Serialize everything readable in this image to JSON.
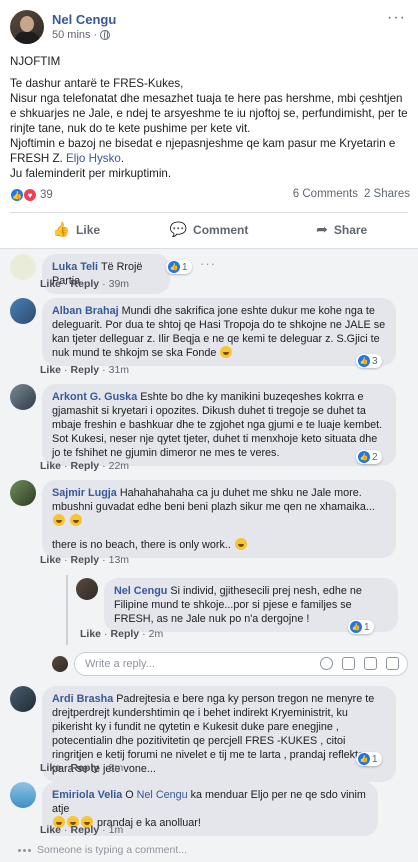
{
  "post": {
    "author": "Nel Cengu",
    "time": "50 mins",
    "meta_sep": "·",
    "heading": "NJOFTIM",
    "paragraph_1": "Te dashur antarë te FRES-Kukes,",
    "paragraph_2": "Nisur nga telefonatat dhe mesazhet tuaja te here pas hershme, mbi çeshtjen e shkuarjes ne Jale, e ndej te arsyeshme te iu njoftoj se, perfundimisht, per te rinjte tane, nuk do te kete pushime per kete vit.",
    "paragraph_3_before": "Njoftimin e bazoj ne bisedat e njepasnjeshme qe kam pasur me Kryetarin e FRESH Z. ",
    "paragraph_3_mention": "Eljo Hysko",
    "paragraph_3_after": ".",
    "paragraph_4": "Ju faleminderit per mirkuptimin.",
    "reaction_count": "39",
    "comments_count": "6 Comments",
    "shares_count": "2 Shares",
    "like_label": "Like",
    "comment_label": "Comment",
    "share_label": "Share"
  },
  "comments": [
    {
      "author": "Luka Teli",
      "text": "Të Rrojë Partia",
      "like": "Like",
      "reply": "Reply",
      "time": "39m",
      "reactions": "1"
    },
    {
      "author": "Alban Brahaj",
      "text": "Mundi dhe sakrifica jone eshte dukur me kohe nga te deleguarit. Por dua te shtoj qe Hasi Tropoja do te shkojne ne JALE se kan tjeter delleguar z. Ilir Beqja e ne qe kemi te deleguar z. S.Gjici te nuk mund te shkojm se ska Fonde",
      "like": "Like",
      "reply": "Reply",
      "time": "31m",
      "reactions": "3"
    },
    {
      "author": "Arkont G. Guska",
      "text": "Eshte bo dhe ky manikini buzeqeshes kokrra e gjamashit si kryetari i opozites. Dikush duhet ti tregoje se duhet ta mbaje freshin e bashkuar dhe te zgjohet nga gjumi e te luaje kembet. Sot Kukesi, neser nje qytet tjeter, duhet ti menxhoje keto situata dhe jo te fshihet ne gjumin dimeror ne mes te veres.",
      "like": "Like",
      "reply": "Reply",
      "time": "22m",
      "reactions": "2"
    },
    {
      "author": "Sajmir Lugja",
      "text": "Hahahahahaha ca ju duhet me shku ne Jale more. mbushni guvadat edhe beni beni plazh sikur me qen ne xhamaika...",
      "text_2": "there is no beach, there is only work..",
      "like": "Like",
      "reply": "Reply",
      "time": "13m"
    },
    {
      "author": "Nel Cengu",
      "text": "Si individ, gjithesecili prej nesh, edhe ne Filipine mund te shkoje...por si pjese e familjes se FRESH, as ne Jale nuk po n'a dergojne !",
      "like": "Like",
      "reply": "Reply",
      "time": "2m",
      "reactions": "1"
    },
    {
      "author": "Ardi Brasha",
      "text": "Padrejtesia e bere nga ky person tregon ne menyre te drejtperdrejt kundershtimin qe i behet indirekt Kryeministrit, ku pikerisht ky i fundit ne qytetin e Kukesit duke pare enegjine , potecentialin dhe pozitivitetin qe percjell FRES -KUKES , citoi ringritjen e ketij forumi ne nivelet e tij me te larta , prandaj reflekto para se te jete vone...",
      "like": "Like",
      "reply": "Reply",
      "time": "8m",
      "reactions": "1"
    },
    {
      "author": "Emiriola Velia",
      "text_before": "O ",
      "mention": "Nel Cengu",
      "text_after": " ka menduar Eljo per ne qe sdo vinim atje",
      "text_2": "prandaj e ka anolluar!",
      "like": "Like",
      "reply": "Reply",
      "time": "1m"
    }
  ],
  "reply_box": {
    "placeholder": "Write a reply..."
  },
  "typing": "Someone is typing a comment...",
  "colors": {
    "link": "#385898",
    "bubble": "#e4e6eb",
    "like_blue": "#1877f2",
    "love_red": "#f33e58"
  }
}
